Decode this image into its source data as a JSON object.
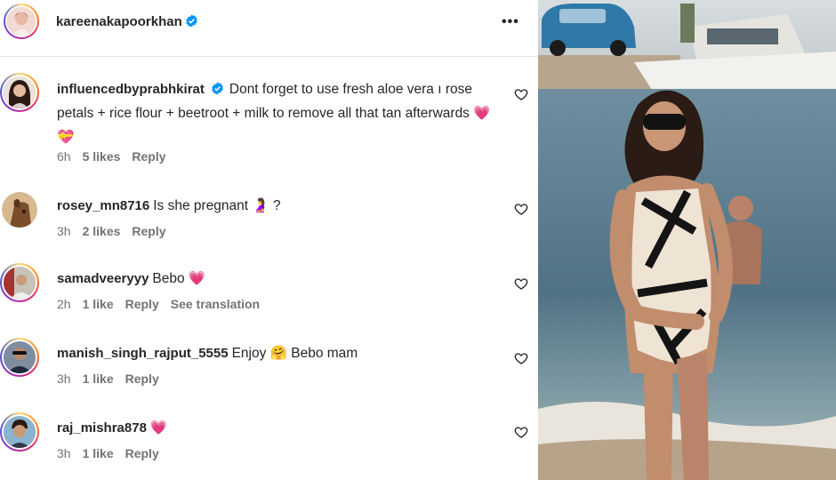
{
  "colors": {
    "accent": "#0095f6",
    "text": "#262626",
    "muted": "#737373",
    "heart": "#ed4956"
  },
  "post": {
    "author": "kareenakapoorkhan",
    "verified": true,
    "more_icon": "more-horizontal-icon"
  },
  "comments": [
    {
      "user": "influencedbyprabhkirat",
      "verified": true,
      "text": "Dont forget to use fresh aloe vera ı rose petals + rice flour + beetroot + milk to remove all that tan afterwards 💗 💝",
      "time": "6h",
      "likes": "5 likes",
      "reply": "Reply"
    },
    {
      "user": "rosey_mn8716",
      "text": "Is she pregnant 🤰 ?",
      "time": "3h",
      "likes": "2 likes",
      "reply": "Reply"
    },
    {
      "user": "samadveeryyy",
      "text": "Bebo 💗",
      "time": "2h",
      "likes": "1 like",
      "reply": "Reply",
      "translate": "See translation"
    },
    {
      "user": "manish_singh_rajput_5555",
      "text": "Enjoy 🤗  Bebo mam",
      "time": "3h",
      "likes": "1 like",
      "reply": "Reply"
    },
    {
      "user": "raj_mishra878",
      "text": "💗",
      "time": "3h",
      "likes": "1 like",
      "reply": "Reply"
    }
  ]
}
